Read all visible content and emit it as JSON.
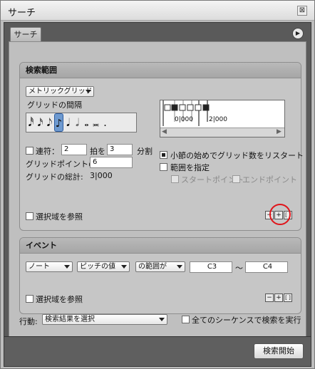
{
  "window": {
    "title": "サーチ",
    "close_glyph": "⊠"
  },
  "tab": {
    "label": "サーチ",
    "menu_glyph": "▶"
  },
  "search_range": {
    "header": "検索範囲",
    "grid_type": "メトリックグリッド",
    "grid_interval_label": "グリッドの間隔",
    "notes": [
      "𝅘𝅥𝅰",
      "𝅘𝅥𝅯",
      "𝅘𝅥𝅮",
      "♪",
      "𝅘𝅥",
      "𝅗𝅥",
      "𝅝",
      "𝅜",
      "."
    ],
    "selected_note_index": 3,
    "tuplet_label": "連符：",
    "tuplet_value": "2",
    "tuplet_beats_label": "拍を",
    "tuplet_beats_value": "3",
    "tuplet_split_label": "分割",
    "grid_points_label": "グリッドポイントの数:",
    "grid_points_value": "6",
    "grid_total_label": "グリッドの総計:",
    "grid_total_value": "3|000",
    "grid_ruler_1": "0|000",
    "grid_ruler_2": "2|000",
    "restart_label": "小節の始めでグリッド数をリスタート",
    "range_label": "範囲を指定",
    "start_point_label": "スタートポイント",
    "end_point_label": "エンドポイント",
    "ref_selection_label": "選択域を参照",
    "minus": "−",
    "plus": "+",
    "bracket": "[ ]"
  },
  "events": {
    "header": "イベント",
    "type": "ノート",
    "property": "ピッチの値",
    "condition": "の範囲が",
    "from": "C3",
    "tilde": "〜",
    "to": "C4",
    "ref_selection_label": "選択域を参照",
    "minus": "−",
    "plus": "+",
    "bracket": "[ ]"
  },
  "action": {
    "label": "行動:",
    "value": "検索結果を選択",
    "all_sequences_label": "全てのシーケンスで検索を実行"
  },
  "search_button": "検索開始",
  "annotation_color": "#e0141a"
}
